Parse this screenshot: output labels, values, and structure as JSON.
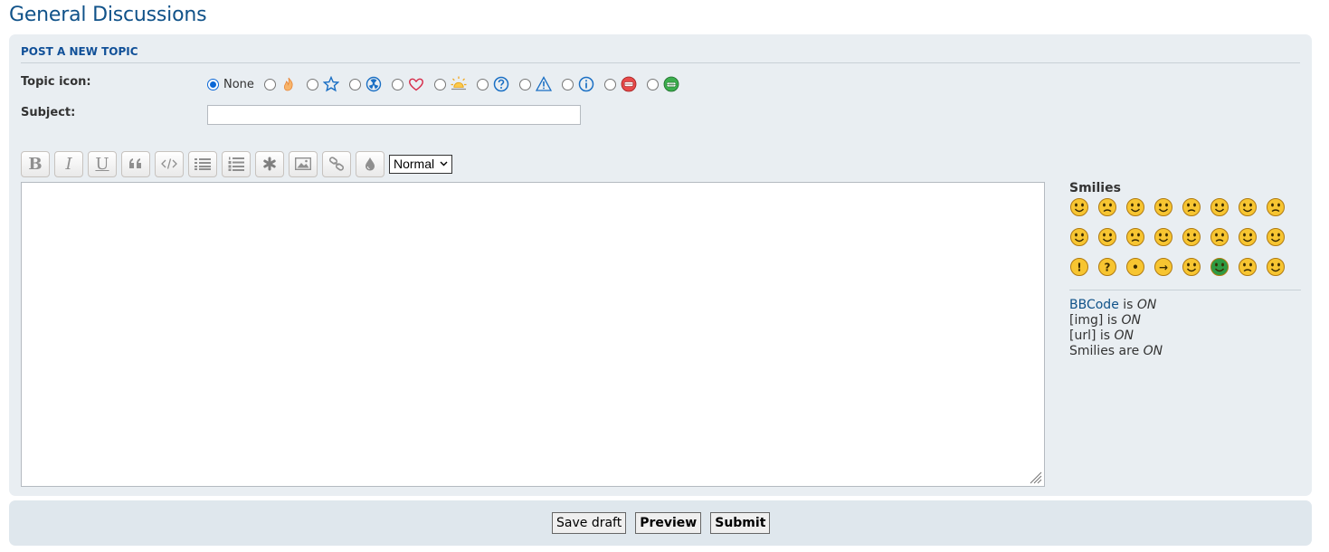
{
  "page": {
    "title": "General Discussions"
  },
  "form": {
    "heading": "POST A NEW TOPIC",
    "topic_icon_label": "Topic icon:",
    "topic_icon_none": "None",
    "topic_icons": [
      "fire-icon",
      "star-icon",
      "radioactive-icon",
      "heart-icon",
      "sun-icon",
      "question-icon",
      "warning-icon",
      "info-icon",
      "mrgreen-red-icon",
      "mrgreen-icon"
    ],
    "subject_label": "Subject:",
    "subject_value": ""
  },
  "toolbar": {
    "buttons": [
      "bold",
      "italic",
      "underline",
      "quote",
      "code",
      "list",
      "list-numbered",
      "list-item",
      "image",
      "link",
      "color"
    ],
    "font_size_selected": "Normal"
  },
  "smilies": {
    "title": "Smilies",
    "items": [
      "very-happy",
      "smile",
      "wink",
      "sad",
      "surprised",
      "shocked",
      "confused",
      "cool",
      "laughing",
      "mad",
      "razz",
      "embarrassed",
      "crying",
      "evil",
      "twisted-evil",
      "rolling-eyes",
      "exclamation",
      "question",
      "idea",
      "arrow",
      "neutral",
      "mr-green",
      "geek",
      "uber-geek"
    ]
  },
  "status": {
    "bbcode_link": "BBCode",
    "bbcode_is": "is",
    "bbcode_state": "ON",
    "img_label": "[img] is",
    "img_state": "ON",
    "url_label": "[url] is",
    "url_state": "ON",
    "smilies_label": "Smilies are",
    "smilies_state": "ON"
  },
  "actions": {
    "save_draft": "Save draft",
    "preview": "Preview",
    "submit": "Submit"
  }
}
